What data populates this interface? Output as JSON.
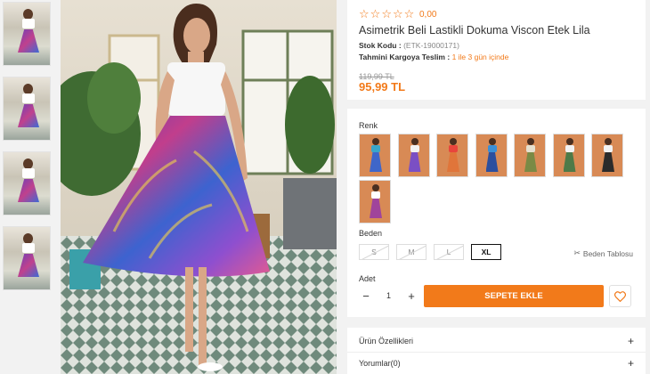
{
  "product": {
    "rating_value": "0,00",
    "rating_stars": 5,
    "title": "Asimetrik Beli Lastikli Dokuma Viscon Etek Lila",
    "stock_code_label": "Stok Kodu :",
    "stock_code_value": "(ETK-19000171)",
    "delivery_label": "Tahmini Kargoya Teslim :",
    "delivery_value": "1 ile 3 gün içinde",
    "old_price": "119,99 TL",
    "price": "95,99 TL"
  },
  "options": {
    "color_label": "Renk",
    "size_label": "Beden",
    "sizes": [
      {
        "label": "S",
        "state": "disabled"
      },
      {
        "label": "M",
        "state": "disabled"
      },
      {
        "label": "L",
        "state": "disabled"
      },
      {
        "label": "XL",
        "state": "selected"
      }
    ],
    "size_table_label": "Beden Tablosu",
    "swatch_colors": [
      {
        "skirt": "#3f66c9",
        "top": "#3aa6c9"
      },
      {
        "skirt": "#7b4fc4",
        "top": "#f2f2f2"
      },
      {
        "skirt": "#e0753a",
        "top": "#e8453c"
      },
      {
        "skirt": "#2c4f9e",
        "top": "#3b8fd6"
      },
      {
        "skirt": "#7a8a45",
        "top": "#e6e0cf"
      },
      {
        "skirt": "#4d7a48",
        "top": "#f2f2f2"
      },
      {
        "skirt": "#2b2b2b",
        "top": "#f2f2f2"
      },
      {
        "skirt": "#a0449b",
        "top": "#ffffff"
      }
    ]
  },
  "cart": {
    "qty_label": "Adet",
    "qty_value": "1",
    "minus": "−",
    "plus": "+",
    "add_to_cart": "SEPETE EKLE"
  },
  "accordion": [
    {
      "label": "Ürün Özellikleri"
    },
    {
      "label": "Yorumlar(0)"
    }
  ],
  "colors": {
    "accent": "#f27a1a"
  }
}
